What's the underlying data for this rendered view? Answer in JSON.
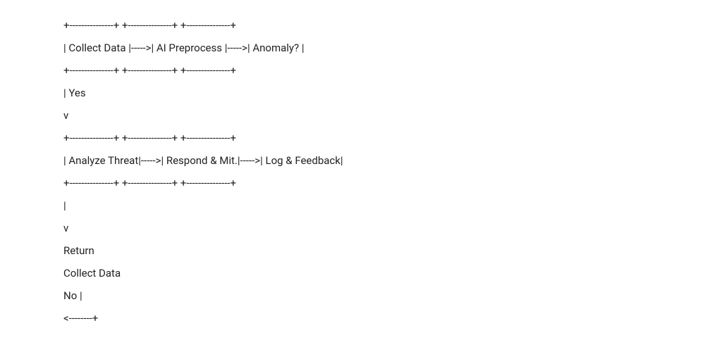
{
  "lines": {
    "l0": "+---------------+ +---------------+ +---------------+",
    "l1": "| Collect Data |----->| AI Preprocess |----->| Anomaly? |",
    "l2": "+---------------+ +---------------+ +---------------+",
    "l3": "| Yes",
    "l4": "v",
    "l5": "+---------------+ +---------------+ +---------------+",
    "l6": "| Analyze Threat|----->| Respond & Mit.|----->| Log & Feedback|",
    "l7": "+---------------+ +---------------+ +---------------+",
    "l8": "|",
    "l9": "v",
    "l10": "Return",
    "l11": "Collect Data",
    "l12": "No |",
    "l13": "<--------+"
  }
}
